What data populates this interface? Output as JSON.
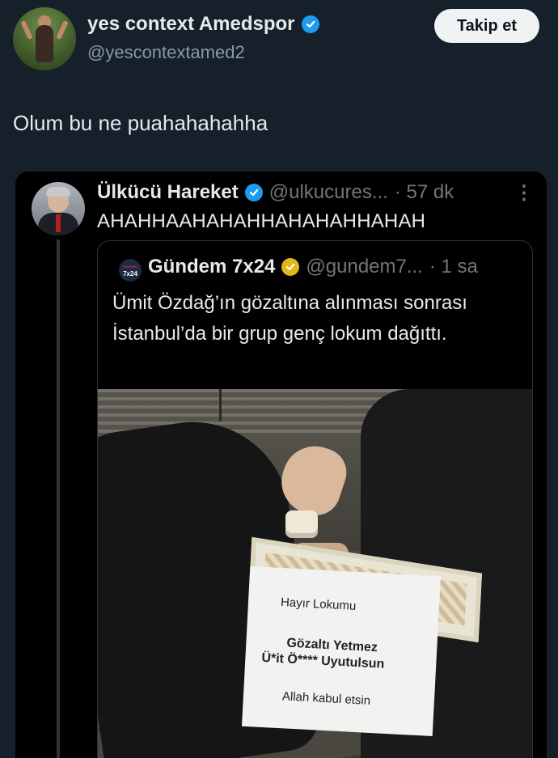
{
  "tweet": {
    "author_name": "yes context Amedspor",
    "author_handle": "@yescontextamed2",
    "follow_label": "Takip et",
    "text": "Olum bu ne puahahahahha"
  },
  "quoted": {
    "author_name": "Ülkücü Hareket",
    "author_handle": "@ulkucures...",
    "time": "· 57 dk",
    "more_icon": "⋮",
    "text": "AHAHHAAHAHAHHAHAHAHHAHAH"
  },
  "inner_quoted": {
    "avatar_text_top": "GÜNDEM",
    "avatar_text_bottom": "7x24",
    "author_name": "Gündem 7x24",
    "author_handle": "@gundem7...",
    "time": "· 1 sa",
    "text": "Ümit Özdağ’ın gözaltına alınması sonrası İstanbul’da bir grup genç lokum dağıttı."
  },
  "photo_note": {
    "line1": "Hayır Lokumu",
    "line2": "Gözaltı Yetmez",
    "line3": "Ü*it Ö**** Uyutulsun",
    "line4": "Allah kabul etsin"
  },
  "colors": {
    "background": "#15202b",
    "verified_blue": "#1d9bf0",
    "gold_badge": "#e2b719"
  }
}
